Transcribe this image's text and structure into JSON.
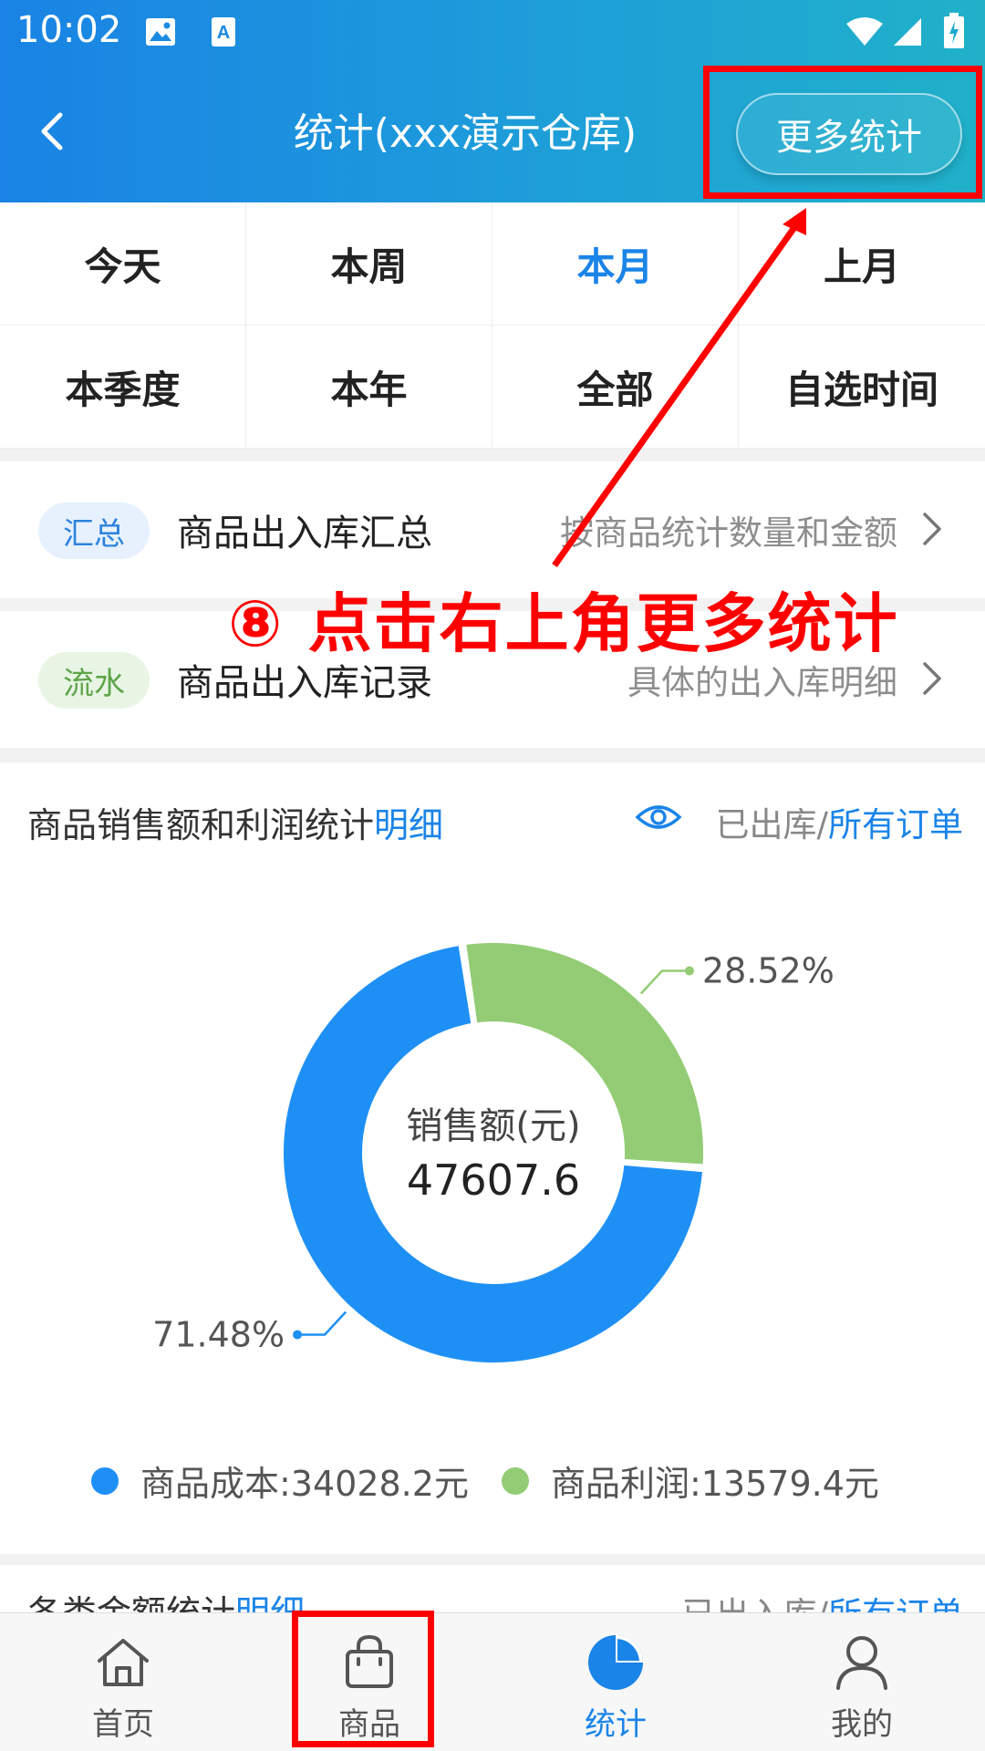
{
  "status_bar": {
    "time": "10:02"
  },
  "header": {
    "title": "统计(xxx演示仓库)",
    "more_button": "更多统计"
  },
  "time_filters": [
    "今天",
    "本周",
    "本月",
    "上月",
    "本季度",
    "本年",
    "全部",
    "自选时间"
  ],
  "active_filter": "本月",
  "entries": [
    {
      "tag": "汇总",
      "name": "商品出入库汇总",
      "desc": "按商品统计数量和金额"
    },
    {
      "tag": "流水",
      "name": "商品出入库记录",
      "desc": "具体的出入库明细"
    }
  ],
  "chart_card": {
    "title": "商品销售额和利润统计",
    "title_link": "明细",
    "filter_text": "已出库/",
    "filter_link": "所有订单"
  },
  "chart_data": {
    "type": "pie",
    "center_label": "销售额(元)",
    "center_value": "47607.6",
    "series": [
      {
        "name": "商品成本:34028.2元",
        "value": 71.48,
        "label": "71.48%",
        "color": "#1e90f5"
      },
      {
        "name": "商品利润:13579.4元",
        "value": 28.52,
        "label": "28.52%",
        "color": "#93cc74"
      }
    ]
  },
  "next_card": {
    "title": "各类金额统计",
    "title_link": "明细",
    "filter_text": "已出入库/",
    "filter_link": "所有订单"
  },
  "tabbar": [
    {
      "label": "首页",
      "icon": "home-icon"
    },
    {
      "label": "商品",
      "icon": "bag-icon"
    },
    {
      "label": "统计",
      "icon": "pie-chart-icon"
    },
    {
      "label": "我的",
      "icon": "user-icon"
    }
  ],
  "annotation": {
    "text": "⑧ 点击右上角更多统计",
    "color": "#ff0000"
  }
}
